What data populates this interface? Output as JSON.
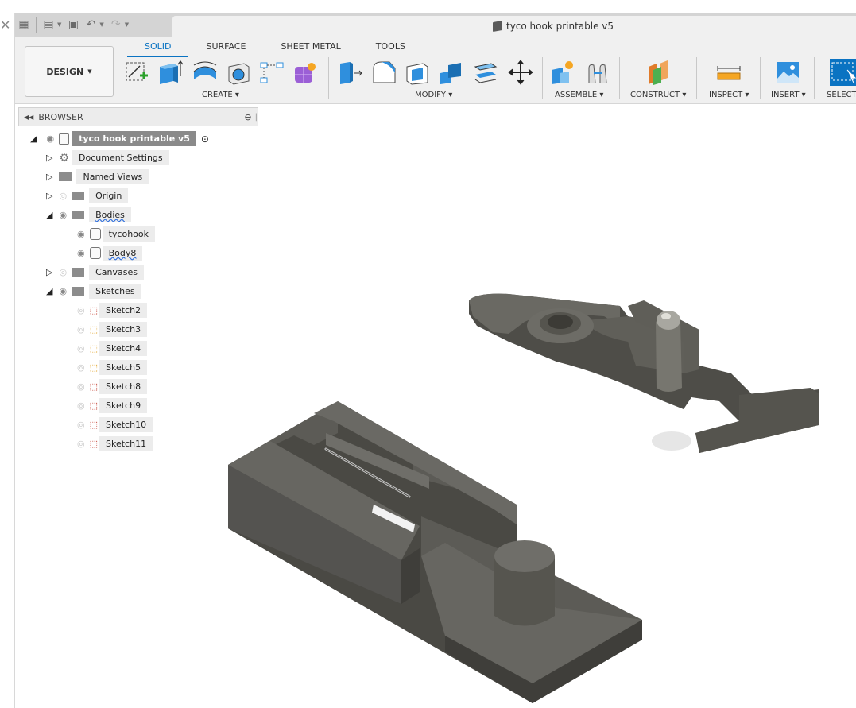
{
  "document": {
    "title": "tyco hook printable v5"
  },
  "ribbon": {
    "workspace_label": "DESIGN",
    "tabs": [
      {
        "label": "SOLID",
        "active": true
      },
      {
        "label": "SURFACE",
        "active": false
      },
      {
        "label": "SHEET METAL",
        "active": false
      },
      {
        "label": "TOOLS",
        "active": false
      }
    ],
    "groups": {
      "create": "CREATE",
      "modify": "MODIFY",
      "assemble": "ASSEMBLE",
      "construct": "CONSTRUCT",
      "inspect": "INSPECT",
      "insert": "INSERT",
      "select": "SELECT"
    }
  },
  "browser": {
    "header": "BROWSER",
    "root": "tyco hook printable v5",
    "items": [
      {
        "label": "Document Settings",
        "icon": "gear-icon"
      },
      {
        "label": "Named Views",
        "icon": "folder-icon"
      },
      {
        "label": "Origin",
        "icon": "folder-icon"
      },
      {
        "label": "Bodies",
        "icon": "folder-icon"
      },
      {
        "label": "tycohook",
        "icon": "body-icon"
      },
      {
        "label": "Body8",
        "icon": "body-icon"
      },
      {
        "label": "Canvases",
        "icon": "folder-icon"
      },
      {
        "label": "Sketches",
        "icon": "folder-icon"
      }
    ],
    "sketches": [
      "Sketch2",
      "Sketch3",
      "Sketch4",
      "Sketch5",
      "Sketch8",
      "Sketch9",
      "Sketch10",
      "Sketch11"
    ]
  },
  "colors": {
    "accent": "#0a73c2",
    "model": "#5b5a55",
    "ribbon_bg": "#f0f0f0"
  }
}
